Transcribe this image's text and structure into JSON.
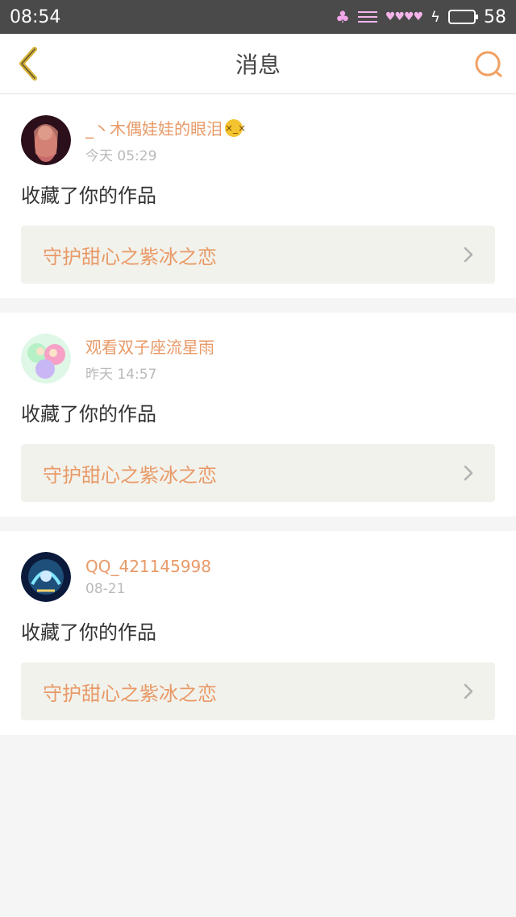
{
  "status": {
    "time": "08:54",
    "battery": "58"
  },
  "header": {
    "title": "消息"
  },
  "messages": [
    {
      "username": "_丶木偶娃娃的眼泪",
      "has_emoji": true,
      "time": "今天 05:29",
      "action": "收藏了你的作品",
      "work_title": "守护甜心之紫冰之恋",
      "avatar_colors": [
        "#2b0f1a",
        "#d78a7a"
      ]
    },
    {
      "username": "观看双子座流星雨",
      "has_emoji": false,
      "time": "昨天 14:57",
      "action": "收藏了你的作品",
      "work_title": "守护甜心之紫冰之恋",
      "avatar_colors": [
        "#b6f0c6",
        "#f7a1c7"
      ]
    },
    {
      "username": "QQ_421145998",
      "has_emoji": false,
      "time": "08-21",
      "action": "收藏了你的作品",
      "work_title": "守护甜心之紫冰之恋",
      "avatar_colors": [
        "#0b1a3a",
        "#7fe6ff"
      ]
    }
  ],
  "colors": {
    "accent": "#e89a68",
    "back_icon": "#d6b23a"
  }
}
